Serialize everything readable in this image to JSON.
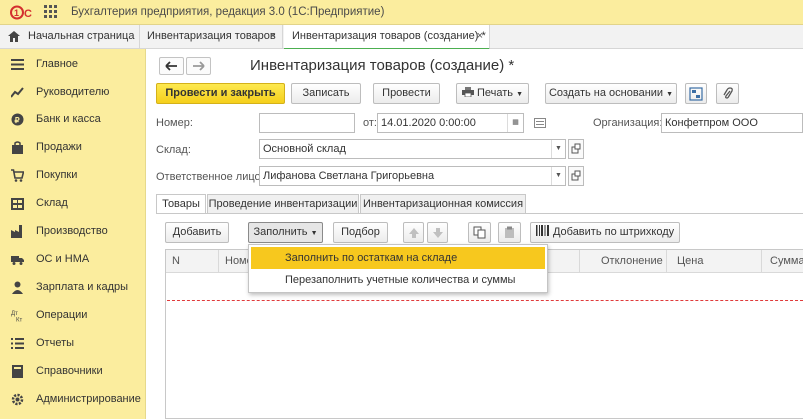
{
  "window": {
    "title": "Бухгалтерия предприятия, редакция 3.0  (1С:Предприятие)"
  },
  "tabs": {
    "home": "Начальная страница",
    "items": [
      {
        "label": "Инвентаризация товаров",
        "close": "×"
      },
      {
        "label": "Инвентаризация товаров (создание) *",
        "close": "×"
      }
    ]
  },
  "sidebar": {
    "items": [
      {
        "label": "Главное",
        "icon": "menu-icon"
      },
      {
        "label": "Руководителю",
        "icon": "trend-icon"
      },
      {
        "label": "Банк и касса",
        "icon": "coin-icon"
      },
      {
        "label": "Продажи",
        "icon": "bag-icon"
      },
      {
        "label": "Покупки",
        "icon": "cart-icon"
      },
      {
        "label": "Склад",
        "icon": "warehouse-icon"
      },
      {
        "label": "Производство",
        "icon": "factory-icon"
      },
      {
        "label": "ОС и НМА",
        "icon": "truck-icon"
      },
      {
        "label": "Зарплата и кадры",
        "icon": "people-icon"
      },
      {
        "label": "Операции",
        "icon": "operations-icon"
      },
      {
        "label": "Отчеты",
        "icon": "report-icon"
      },
      {
        "label": "Справочники",
        "icon": "book-icon"
      },
      {
        "label": "Администрирование",
        "icon": "gear-icon"
      }
    ]
  },
  "form": {
    "title": "Инвентаризация товаров (создание) *",
    "toolbar": {
      "post_close": "Провести и закрыть",
      "save": "Записать",
      "post": "Провести",
      "print": "Печать",
      "create_based": "Создать на основании"
    },
    "fields": {
      "number_label": "Номер:",
      "number_value": "",
      "date_label": "от:",
      "date_value": "14.01.2020  0:00:00",
      "org_label": "Организация:",
      "org_value": "Конфетпром ООО",
      "warehouse_label": "Склад:",
      "warehouse_value": "Основной склад",
      "responsible_label": "Ответственное лицо:",
      "responsible_value": "Лифанова Светлана Григорьевна"
    },
    "form_tabs": [
      "Товары",
      "Проведение инвентаризации",
      "Инвентаризационная комиссия"
    ],
    "table_toolbar": {
      "add": "Добавить",
      "fill": "Заполнить",
      "select": "Подбор",
      "barcode": "Добавить по штрихкоду"
    },
    "columns": [
      "N",
      "Номенклатура",
      "Отклонение",
      "Цена",
      "Сумма"
    ],
    "fill_menu": [
      "Заполнить по остаткам на складе",
      "Перезаполнить учетные количества и суммы"
    ]
  },
  "colors": {
    "accent_yellow": "#fbed9e",
    "primary_button": "#f5cf1b",
    "menu_selected": "#f7c81e",
    "active_tab_underline": "#4caf50"
  }
}
